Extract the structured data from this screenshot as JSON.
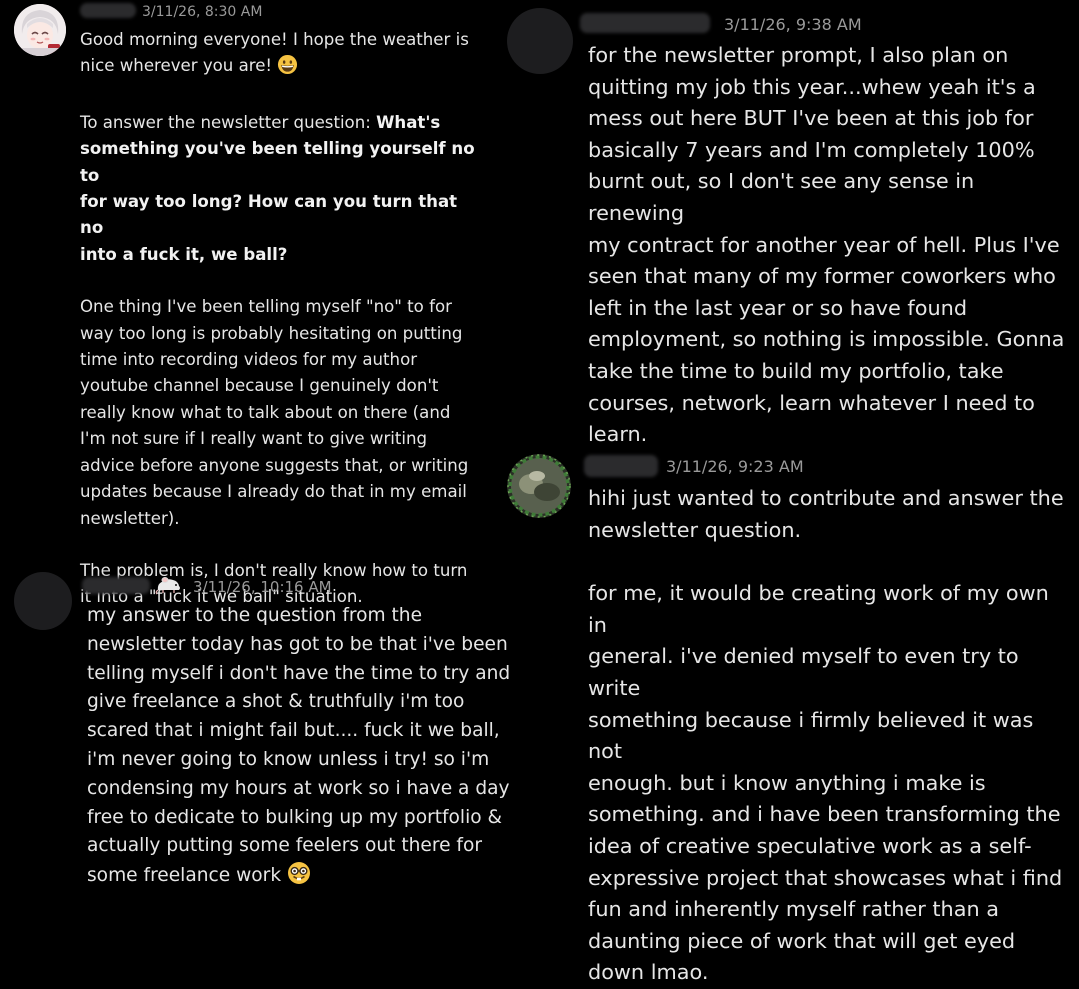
{
  "messages": [
    {
      "timestamp": "3/11/26, 8:30 AM",
      "paragraphs": [
        "Good morning everyone! I hope the weather is\nnice wherever you are!",
        "To answer the newsletter question:",
        "One thing I've been telling myself \"no\" to for\nway too long is probably hesitating on putting\ntime into recording videos for my author\nyoutube channel because I genuinely don't\nreally know what to talk about on there (and\nI'm not sure if I really want to give writing\nadvice before anyone suggests that, or writing\nupdates because I already do that in my email\nnewsletter).",
        "The problem is, I don't really know how to turn\nit into a \"fuck it we ball\" situation."
      ],
      "bold_question": "What's\nsomething you've been telling yourself no to\nfor way too long? How can you turn that no\ninto a fuck it, we ball?"
    },
    {
      "timestamp": "3/11/26, 10:16 AM",
      "paragraphs": [
        "my answer to the question from the\nnewsletter today has got to be that i've been\ntelling myself i don't have the time to try and\ngive freelance a shot & truthfully i'm too\nscared that i might fail but.... fuck it we ball,\ni'm never going to know unless i try! so i'm\ncondensing my hours at work so i have a day\nfree to dedicate to bulking up my portfolio &\nactually putting some feelers out there for\nsome freelance work"
      ]
    },
    {
      "timestamp": "3/11/26, 9:38 AM",
      "paragraphs": [
        "for the newsletter prompt, I also plan on\nquitting my job this year...whew yeah it's a\nmess out here BUT I've been at this job for\nbasically 7 years and I'm completely 100%\nburnt out, so I don't see any sense in renewing\nmy contract for another year of hell. Plus I've\nseen that many of my former coworkers who\nleft in the last year or so have found\nemployment, so nothing is impossible. Gonna\ntake the time to build my portfolio, take\ncourses, network, learn whatever I need to\nlearn."
      ]
    },
    {
      "timestamp": "3/11/26, 9:23 AM",
      "paragraphs": [
        "hihi just wanted to contribute and answer the\nnewsletter question.",
        "for me, it would be creating work of my own in\ngeneral. i've denied myself to even try to write\nsomething because i firmly believed it was not\nenough. but i know anything i make is\nsomething. and i have been transforming the\nidea of creative speculative work as a self-\nexpressive project that showcases what i find\nfun and inherently myself rather than a\ndaunting piece of work that will get eyed\ndown lmao."
      ]
    }
  ],
  "icons": {
    "grin": "grinning-face-emoji",
    "nerd": "nerd-face-emoji",
    "badge": "rat-badge-icon"
  },
  "colors": {
    "background": "#000000",
    "text": "#e6e6e6",
    "timestamp": "#9a9a9a"
  }
}
